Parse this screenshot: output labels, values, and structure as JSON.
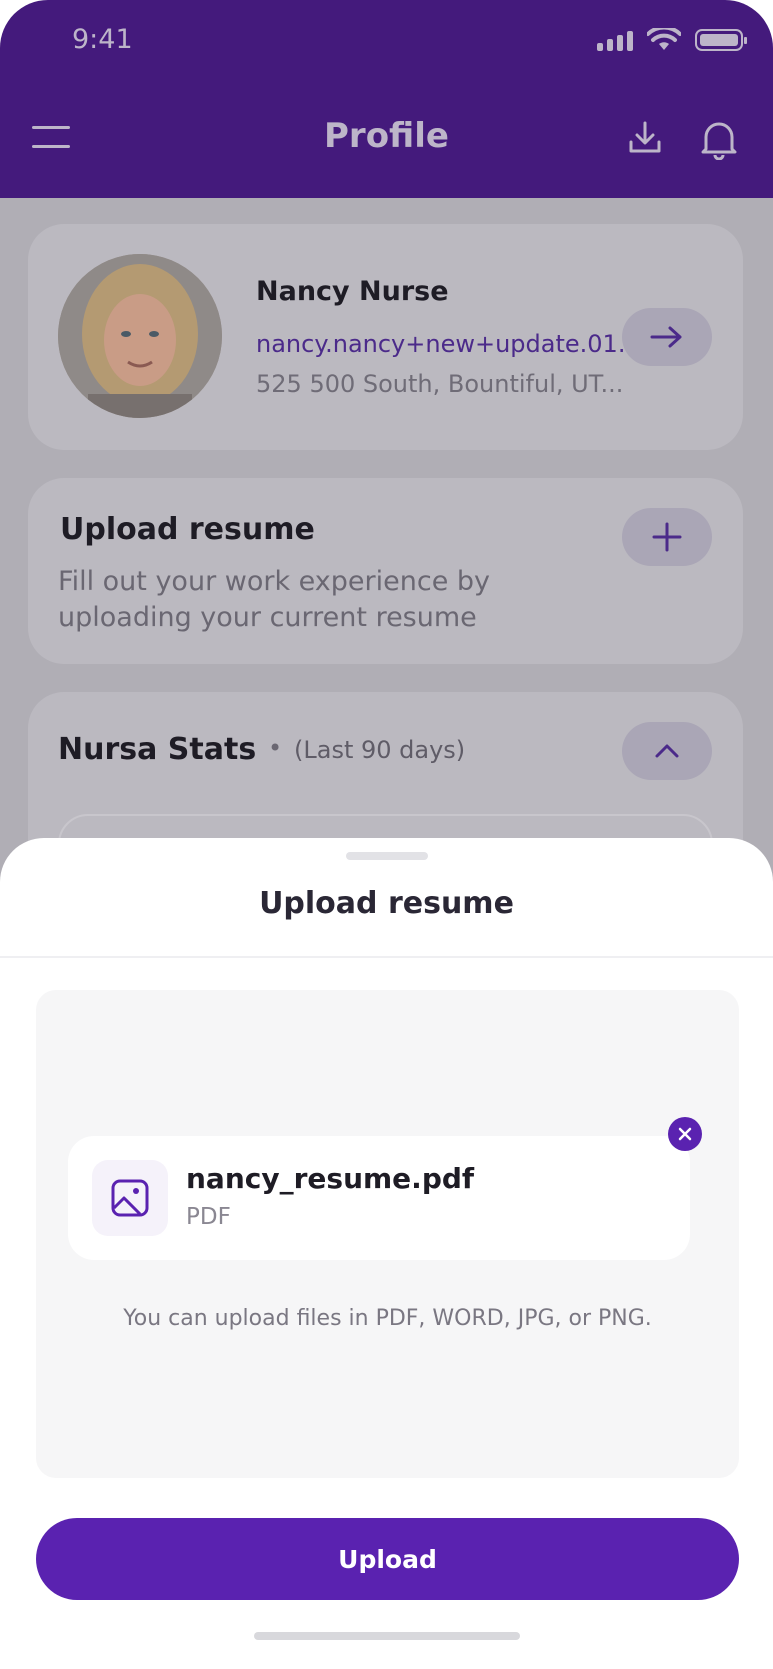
{
  "status_bar": {
    "time": "9:41"
  },
  "header": {
    "title": "Profile"
  },
  "profile": {
    "name": "Nancy Nurse",
    "email": "nancy.nancy+new+update.01...",
    "address": "525 500 South, Bountiful, UT..."
  },
  "upload_card": {
    "title": "Upload resume",
    "description": "Fill out your work experience by uploading your current resume"
  },
  "stats": {
    "title": "Nursa Stats",
    "separator": "•",
    "period": "(Last 90 days)"
  },
  "sheet": {
    "title": "Upload resume",
    "file": {
      "name": "nancy_resume.pdf",
      "type": "PDF"
    },
    "hint": "You can upload files in PDF, WORD, JPG, or PNG.",
    "upload_label": "Upload"
  },
  "colors": {
    "brand_purple": "#441a7c",
    "accent_purple": "#5a22b0",
    "link_purple": "#4b2a8a"
  }
}
